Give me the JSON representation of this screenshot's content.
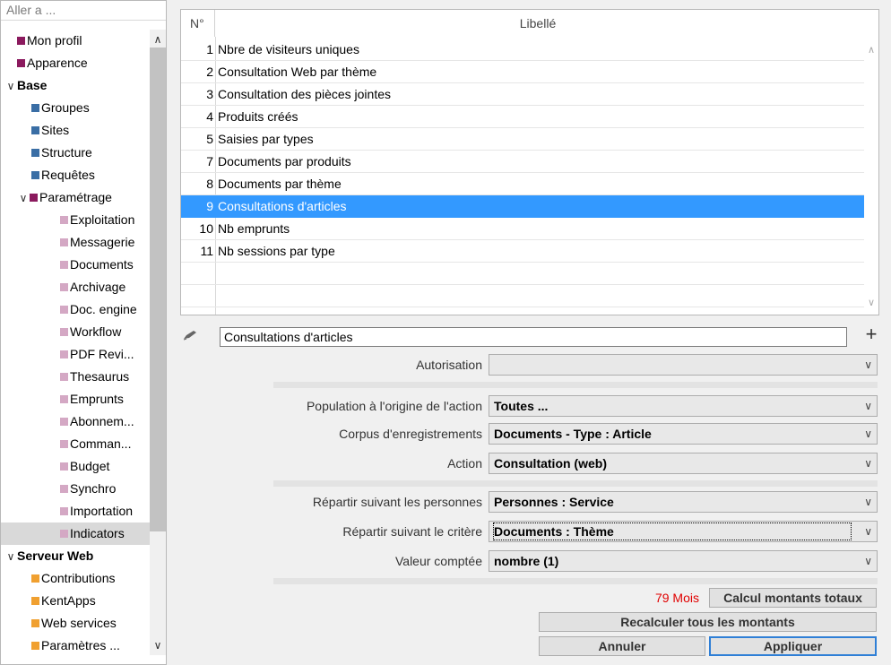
{
  "sidebar": {
    "goto_placeholder": "Aller a ...",
    "items": [
      {
        "label": "Mon profil",
        "indent": 0,
        "color": "#8b1a5e",
        "bold": false
      },
      {
        "label": "Apparence",
        "indent": 0,
        "color": "#8b1a5e",
        "bold": false
      },
      {
        "label": "Base",
        "indent": 0,
        "caret": "∨",
        "bold": true
      },
      {
        "label": "Groupes",
        "indent": 1,
        "color": "#3a6ea5",
        "bold": false
      },
      {
        "label": "Sites",
        "indent": 1,
        "color": "#3a6ea5",
        "bold": false
      },
      {
        "label": "Structure",
        "indent": 1,
        "color": "#3a6ea5",
        "bold": false
      },
      {
        "label": "Requêtes",
        "indent": 1,
        "color": "#3a6ea5",
        "bold": false
      },
      {
        "label": "Paramétrage",
        "indent": 1,
        "caret": "∨",
        "color": "#8b1a5e",
        "bold": false
      },
      {
        "label": "Exploitation",
        "indent": 2,
        "color": "#d4a8c4",
        "bold": false
      },
      {
        "label": "Messagerie",
        "indent": 2,
        "color": "#d4a8c4",
        "bold": false
      },
      {
        "label": "Documents",
        "indent": 2,
        "color": "#d4a8c4",
        "bold": false
      },
      {
        "label": "Archivage",
        "indent": 2,
        "color": "#d4a8c4",
        "bold": false
      },
      {
        "label": "Doc. engine",
        "indent": 2,
        "color": "#d4a8c4",
        "bold": false
      },
      {
        "label": "Workflow",
        "indent": 2,
        "color": "#d4a8c4",
        "bold": false
      },
      {
        "label": "PDF Revi...",
        "indent": 2,
        "color": "#d4a8c4",
        "bold": false
      },
      {
        "label": "Thesaurus",
        "indent": 2,
        "color": "#d4a8c4",
        "bold": false
      },
      {
        "label": "Emprunts",
        "indent": 2,
        "color": "#d4a8c4",
        "bold": false
      },
      {
        "label": "Abonnem...",
        "indent": 2,
        "color": "#d4a8c4",
        "bold": false
      },
      {
        "label": "Comman...",
        "indent": 2,
        "color": "#d4a8c4",
        "bold": false
      },
      {
        "label": "Budget",
        "indent": 2,
        "color": "#d4a8c4",
        "bold": false
      },
      {
        "label": "Synchro",
        "indent": 2,
        "color": "#d4a8c4",
        "bold": false
      },
      {
        "label": "Importation",
        "indent": 2,
        "color": "#d4a8c4",
        "bold": false
      },
      {
        "label": "Indicators",
        "indent": 2,
        "color": "#d4a8c4",
        "bold": false,
        "selected": true
      },
      {
        "label": "Serveur Web",
        "indent": 0,
        "caret": "∨",
        "bold": true
      },
      {
        "label": "Contributions",
        "indent": 1,
        "color": "#f0a030",
        "bold": false
      },
      {
        "label": "KentApps",
        "indent": 1,
        "color": "#f0a030",
        "bold": false
      },
      {
        "label": "Web services",
        "indent": 1,
        "color": "#f0a030",
        "bold": false
      },
      {
        "label": "Paramètres ...",
        "indent": 1,
        "color": "#f0a030",
        "bold": false
      }
    ]
  },
  "table": {
    "col_no": "N°",
    "col_label": "Libellé",
    "rows": [
      {
        "no": "1",
        "label": "Nbre de visiteurs uniques"
      },
      {
        "no": "2",
        "label": "Consultation Web par thème"
      },
      {
        "no": "3",
        "label": "Consultation des pièces jointes"
      },
      {
        "no": "4",
        "label": "Produits créés"
      },
      {
        "no": "5",
        "label": "Saisies par types"
      },
      {
        "no": "7",
        "label": "Documents par produits"
      },
      {
        "no": "8",
        "label": "Documents par thème"
      },
      {
        "no": "9",
        "label": "Consultations d'articles",
        "selected": true
      },
      {
        "no": "10",
        "label": "Nb emprunts"
      },
      {
        "no": "11",
        "label": "Nb sessions par type"
      }
    ]
  },
  "form": {
    "name_value": "Consultations d'articles",
    "autorisation_label": "Autorisation",
    "autorisation_value": "",
    "population_label": "Population à l'origine de l'action",
    "population_value": "Toutes ...",
    "corpus_label": "Corpus d'enregistrements",
    "corpus_value": "Documents - Type : Article",
    "action_label": "Action",
    "action_value": "Consultation (web)",
    "repartir_personnes_label": "Répartir suivant les personnes",
    "repartir_personnes_value": "Personnes : Service",
    "repartir_critere_label": "Répartir suivant le critère",
    "repartir_critere_value": "Documents : Thème",
    "valeur_label": "Valeur comptée",
    "valeur_value": "nombre (1)"
  },
  "footer": {
    "months_text": "79 Mois",
    "calc_totals_button": "Calcul montants totaux",
    "recalc_all_button": "Recalculer tous les montants",
    "cancel_button": "Annuler",
    "apply_button": "Appliquer"
  },
  "colors": {
    "selection": "#3399ff",
    "months_text": "#e00000",
    "primary_border": "#2f7fd6"
  }
}
